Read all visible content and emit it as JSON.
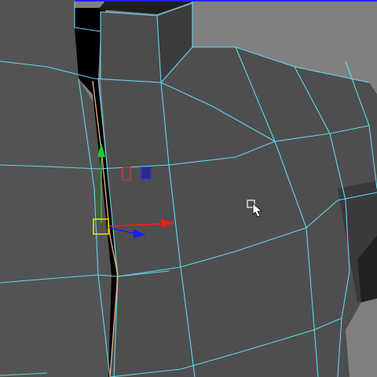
{
  "viewport": {
    "kind": "3d-modeling-viewport",
    "display_mode": "wireframe-on-shaded",
    "colors": {
      "background": "#808080",
      "mesh_face_light": "#565656",
      "mesh_face_mid": "#4b4b4b",
      "mesh_face_dark": "#3a3a3a",
      "mesh_face_shadow": "#1c1c1c",
      "cavity": "#000000",
      "wire": "#5ed8f0",
      "selected_edge": "#e8a878",
      "top_border": "#2222ff"
    }
  },
  "manipulator": {
    "tool": "move-tool",
    "axes": [
      {
        "axis": "x",
        "color": "#ff1a1a",
        "icon": "arrow-cone-icon"
      },
      {
        "axis": "y",
        "color": "#22cc22",
        "icon": "arrow-cone-icon"
      },
      {
        "axis": "z",
        "color": "#1a1aff",
        "icon": "arrow-cone-icon"
      }
    ],
    "center_handle": {
      "color": "#e8e800",
      "icon": "square-handle-icon"
    },
    "plane_handles": [
      {
        "plane": "xy",
        "color": "#cc3333",
        "icon": "square-handle-icon"
      },
      {
        "plane": "yz",
        "color": "#3333cc",
        "icon": "square-handle-icon"
      }
    ]
  },
  "cursor": {
    "icon": "select-arrow-cursor-icon",
    "color": "#ffffff"
  }
}
